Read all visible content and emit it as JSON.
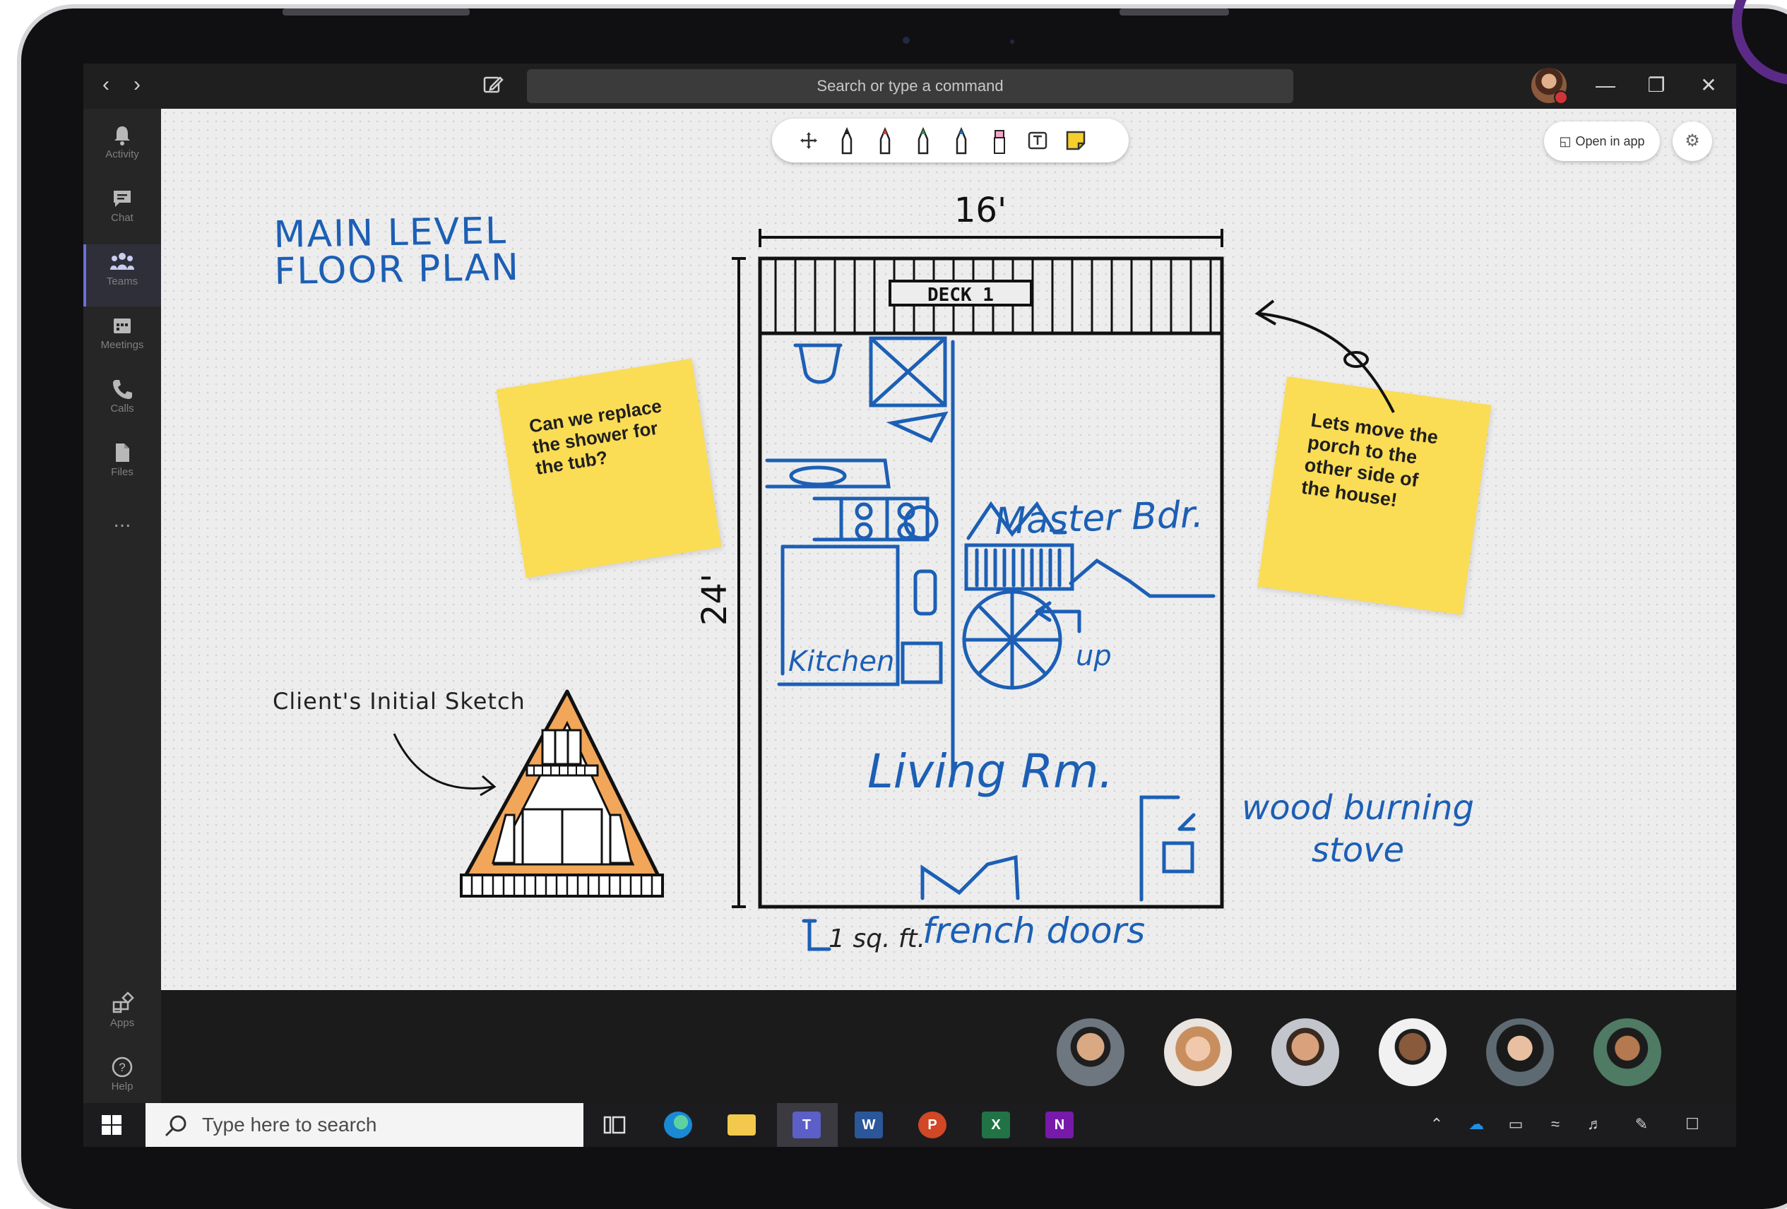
{
  "app": {
    "search_placeholder": "Search or type a command",
    "rail": [
      {
        "label": "Activity",
        "icon": "bell-icon"
      },
      {
        "label": "Chat",
        "icon": "chat-icon"
      },
      {
        "label": "Teams",
        "icon": "teams-icon",
        "active": true
      },
      {
        "label": "Meetings",
        "icon": "calendar-icon"
      },
      {
        "label": "Calls",
        "icon": "phone-icon"
      },
      {
        "label": "Files",
        "icon": "file-icon"
      }
    ],
    "rail_more": "...",
    "rail_bottom": [
      {
        "label": "Apps",
        "icon": "apps-icon"
      },
      {
        "label": "Help",
        "icon": "help-icon"
      }
    ],
    "window_controls": [
      "minimize-icon",
      "restore-icon",
      "close-icon"
    ]
  },
  "whiteboard": {
    "open_in_app": "Open in app",
    "tools": [
      "lasso-select-icon",
      "black-pen-icon",
      "red-pen-icon",
      "green-pen-icon",
      "blue-pen-icon",
      "highlighter-icon",
      "text-box-icon",
      "sticky-note-icon"
    ],
    "title_line1": "MAIN LEVEL",
    "title_line2": "FLOOR PLAN",
    "client_sketch_label": "Client's Initial Sketch",
    "dimension_width": "16'",
    "dimension_height": "24'",
    "deck_label": "DECK 1",
    "labels": {
      "master": "Master Bdr.",
      "kitchen": "Kitchen",
      "up": "up",
      "living": "Living Rm.",
      "stove": "wood burning\nstove",
      "doors": "french doors",
      "scale": "1 sq. ft."
    },
    "sticky_left": "Can we replace\nthe shower for\nthe tub?",
    "sticky_right": "Lets move the\nporch to the\nother side of\nthe house!"
  },
  "taskbar": {
    "search_placeholder": "Type here to search",
    "apps": [
      {
        "name": "task-view-icon"
      },
      {
        "name": "edge-icon",
        "color": "#1a8ad4"
      },
      {
        "name": "file-explorer-icon",
        "color": "#f2c94c"
      },
      {
        "name": "teams-app-icon",
        "color": "#5b5fc7",
        "letter": "T"
      },
      {
        "name": "word-icon",
        "color": "#2b579a",
        "letter": "W"
      },
      {
        "name": "powerpoint-icon",
        "color": "#d24726",
        "letter": "P"
      },
      {
        "name": "excel-icon",
        "color": "#217346",
        "letter": "X"
      },
      {
        "name": "onenote-icon",
        "color": "#7719aa",
        "letter": "N"
      }
    ]
  },
  "colors": {
    "accent": "#6264a7",
    "ink_blue": "#1c5fb5",
    "sticky": "#fbdc55",
    "roof_orange": "#f2a65a"
  }
}
